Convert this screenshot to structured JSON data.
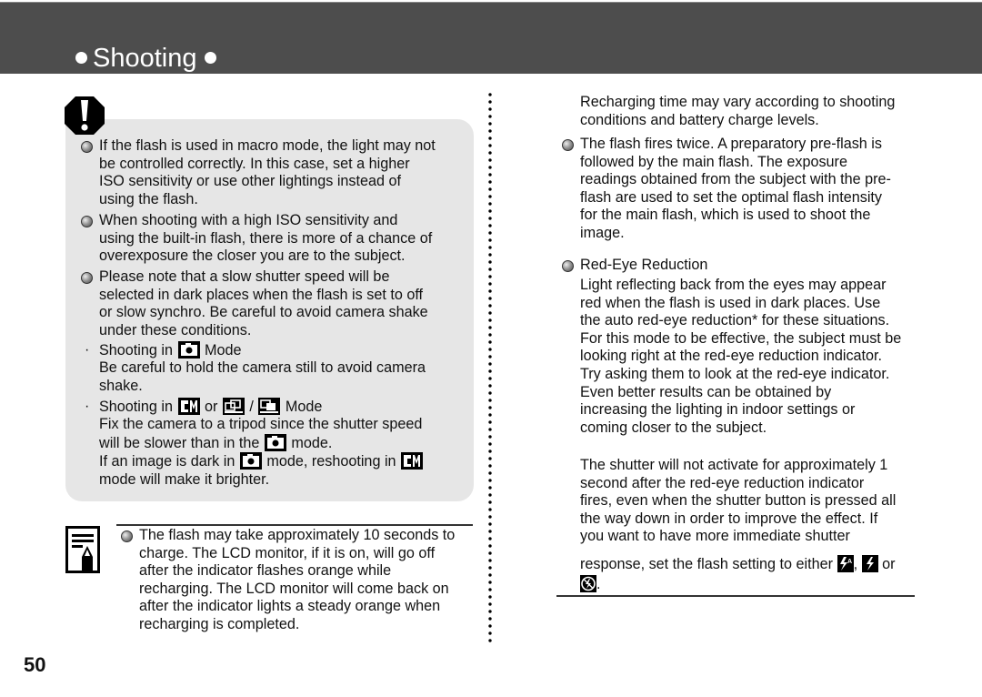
{
  "header": {
    "title": "Shooting"
  },
  "caution": {
    "icon": "exclamation-octagon-icon",
    "items": [
      {
        "type": "bullet",
        "lines": [
          "If the flash is used in macro mode, the light may not",
          "be controlled correctly. In this case, set a higher",
          "ISO sensitivity or use other lightings instead of",
          "using the flash."
        ]
      },
      {
        "type": "bullet",
        "lines": [
          "When shooting with a high ISO sensitivity and",
          "using the built-in flash, there is more of a chance of",
          "overexposure the closer you are to the subject."
        ]
      },
      {
        "type": "bullet",
        "lines": [
          "Please note that a slow shutter speed will be",
          "selected in dark places when the flash is set to off",
          "or slow synchro. Be careful to avoid camera shake",
          "under these conditions."
        ]
      }
    ],
    "mode1": {
      "heading_pre": "Shooting in",
      "heading_post": "Mode",
      "body_lines": [
        "Be careful to hold the camera still to avoid camera",
        "shake."
      ]
    },
    "mode2": {
      "heading_pre": "Shooting in",
      "or": "or",
      "slash": "/",
      "heading_post": "Mode",
      "line1": "Fix the camera to a tripod since the shutter speed",
      "line2_pre": "will be slower than in the",
      "line2_post": "mode.",
      "line3_pre": "If an image is dark in",
      "line3_mid": "mode, reshooting in",
      "line4": "mode will make it brighter."
    },
    "icons": {
      "auto": "camera-auto-mode-icon",
      "manual": "camera-manual-mode-icon",
      "stitch1": "stitch-assist-left-icon",
      "stitch2": "stitch-assist-right-icon"
    }
  },
  "note": {
    "icon": "memo-pencil-icon",
    "lines": [
      "The flash may take approximately 10 seconds to",
      "charge. The LCD monitor, if it is on, will go off",
      "after the indicator flashes orange while",
      "recharging. The LCD monitor will come back on",
      "after the indicator lights a steady orange when",
      "recharging is completed."
    ]
  },
  "right": {
    "cont_lines": [
      "Recharging time may vary according to shooting",
      "conditions and battery charge levels."
    ],
    "flash_twice_lines": [
      "The flash fires twice. A preparatory pre-flash is",
      "followed by the main flash. The exposure",
      "readings obtained from the subject with the pre-",
      "flash are used to set the optimal flash intensity",
      "for the main flash, which is used to shoot the",
      "image."
    ],
    "red_eye_heading": "Red-Eye Reduction",
    "red_eye_lines": [
      "Light reflecting back from the eyes may appear",
      "red when the flash is used in dark places. Use",
      "the auto red-eye reduction* for these situations.",
      "For this mode to be effective, the subject must be",
      "looking right at the red-eye reduction indicator.",
      "Try asking them to look at the red-eye indicator.",
      "Even better results can be obtained by",
      "increasing the lighting in indoor settings or",
      "coming closer to the subject."
    ],
    "shutter_lines": [
      "The shutter will not activate for approximately 1",
      "second after the red-eye reduction indicator",
      "fires, even when the shutter button is pressed all",
      "the way down in order to improve the effect. If",
      "you want to have more immediate shutter"
    ],
    "last_pre": "response, set the flash setting to either",
    "comma": ",",
    "or": "or",
    "period": ".",
    "icons": {
      "auto_flash": "flash-auto-icon",
      "flash_on": "flash-on-icon",
      "flash_off": "flash-off-icon"
    }
  },
  "page_number": "50"
}
